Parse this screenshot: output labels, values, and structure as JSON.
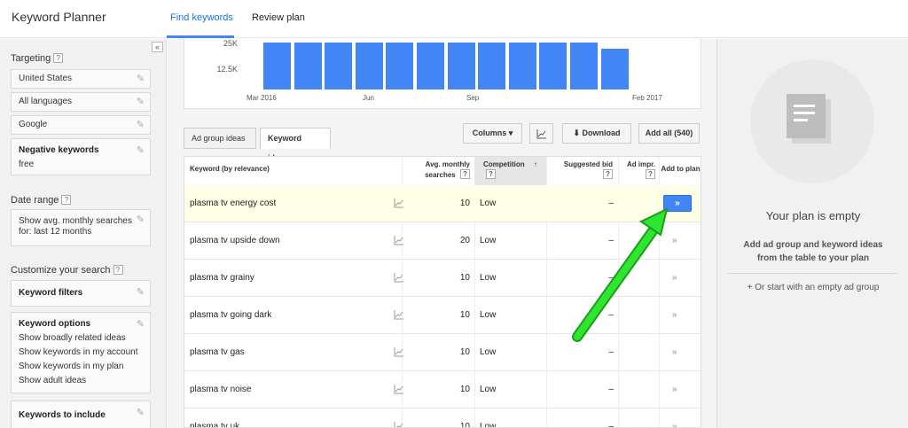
{
  "header": {
    "app_title": "Keyword Planner",
    "tabs": [
      {
        "label": "Find keywords",
        "active": true
      },
      {
        "label": "Review plan",
        "active": false
      }
    ]
  },
  "sidebar": {
    "collapse_label": "«",
    "targeting_heading": "Targeting",
    "targeting_items": [
      "United States",
      "All languages",
      "Google"
    ],
    "negative_title": "Negative keywords",
    "negative_value": "free",
    "date_heading": "Date range",
    "date_text": "Show avg. monthly searches for: last 12 months",
    "customize_heading": "Customize your search",
    "keyword_filters_label": "Keyword filters",
    "keyword_options_title": "Keyword options",
    "keyword_options": [
      "Show broadly related ideas",
      "Show keywords in my account",
      "Show keywords in my plan",
      "Show adult ideas"
    ],
    "keywords_include_label": "Keywords to include"
  },
  "chart_data": {
    "type": "bar",
    "categories": [
      "Mar 2016",
      "",
      "",
      "Jun",
      "",
      "",
      "Sep",
      "",
      "",
      "",
      "",
      "Feb 2017"
    ],
    "values": [
      33,
      33,
      33,
      33,
      33,
      33,
      33,
      33,
      33,
      33,
      33,
      29
    ],
    "y_unit": "K",
    "yticks": [
      "25K",
      "12.5K"
    ],
    "xtick_labels": [
      "Mar 2016",
      "Jun",
      "Sep",
      "Feb 2017"
    ],
    "color": "#4285f4"
  },
  "tabs": {
    "ad_group": "Ad group ideas",
    "keyword_ideas": "Keyword ideas"
  },
  "toolbar": {
    "columns": "Columns ▾",
    "download": "Download",
    "add_all": "Add all (540)"
  },
  "table": {
    "headers": {
      "keyword": "Keyword (by relevance)",
      "avg": "Avg. monthly searches",
      "competition": "Competition",
      "bid": "Suggested bid",
      "impr": "Ad impr.",
      "add": "Add to plan"
    },
    "rows": [
      {
        "keyword": "plasma tv energy cost",
        "searches": "10",
        "competition": "Low",
        "bid": "–",
        "highlight": true
      },
      {
        "keyword": "plasma tv upside down",
        "searches": "20",
        "competition": "Low",
        "bid": "–"
      },
      {
        "keyword": "plasma tv grainy",
        "searches": "10",
        "competition": "Low",
        "bid": "–"
      },
      {
        "keyword": "plasma tv going dark",
        "searches": "10",
        "competition": "Low",
        "bid": "–"
      },
      {
        "keyword": "plasma tv gas",
        "searches": "10",
        "competition": "Low",
        "bid": "–"
      },
      {
        "keyword": "plasma tv noise",
        "searches": "10",
        "competition": "Low",
        "bid": "–"
      },
      {
        "keyword": "plasma tv uk",
        "searches": "10",
        "competition": "Low",
        "bid": "–"
      }
    ],
    "add_symbol": "»"
  },
  "plan": {
    "title": "Your plan is empty",
    "subtitle": "Add ad group and keyword ideas from the table to your plan",
    "link": "+ Or start with an empty ad group"
  },
  "colors": {
    "accent": "#4285f4",
    "arrow": "#2ee62e"
  }
}
